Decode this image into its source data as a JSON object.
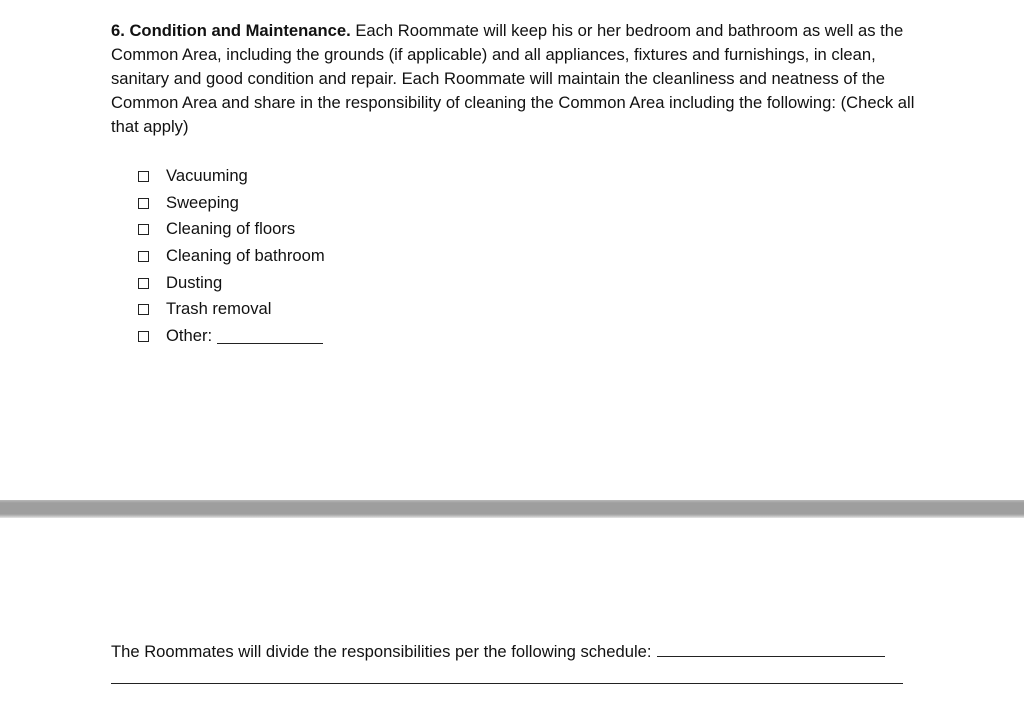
{
  "section": {
    "heading": "6. Condition and Maintenance.",
    "body": "Each Roommate will keep his or her bedroom and bathroom as well as the Common Area, including the grounds (if applicable) and all appliances, fixtures and furnishings, in clean, sanitary and good condition and repair. Each Roommate will maintain the cleanliness and neatness of the Common Area and share in the responsibility of cleaning the Common Area including the following: (Check all that apply)"
  },
  "checklist": {
    "items": [
      {
        "label": "Vacuuming",
        "checked": false
      },
      {
        "label": "Sweeping",
        "checked": false
      },
      {
        "label": "Cleaning of floors",
        "checked": false
      },
      {
        "label": "Cleaning of bathroom",
        "checked": false
      },
      {
        "label": "Dusting",
        "checked": false
      },
      {
        "label": "Trash removal",
        "checked": false
      },
      {
        "label": "Other:",
        "checked": false
      }
    ]
  },
  "schedule": {
    "text": "The Roommates will divide the responsibilities per the following schedule:"
  }
}
